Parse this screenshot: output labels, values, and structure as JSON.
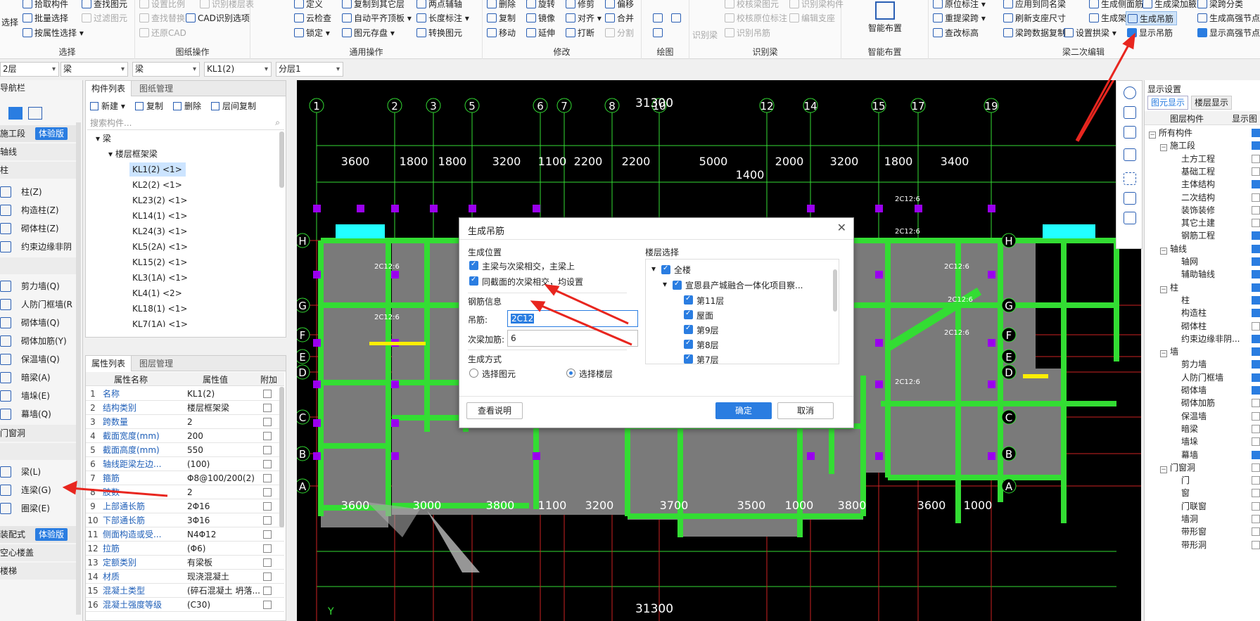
{
  "ribbon": {
    "row1": [
      {
        "label": "拾取构件"
      },
      {
        "label": "查找图元"
      },
      {
        "label": "设置比例"
      },
      {
        "label": "识别楼层表"
      },
      {
        "label": "定义"
      },
      {
        "label": "复制到其它层"
      },
      {
        "label": "两点辅轴"
      },
      {
        "label": "删除"
      },
      {
        "label": "旋转"
      },
      {
        "label": "修剪"
      },
      {
        "label": "偏移"
      },
      {
        "label": "原位标注"
      },
      {
        "label": "应用到同名梁"
      },
      {
        "label": "生成侧面筋"
      },
      {
        "label": "生成架立筋"
      },
      {
        "label": "梁跨分类"
      }
    ],
    "select_label": "选择",
    "select_items": [
      {
        "label": "批量选择"
      },
      {
        "label": "按属性选择"
      },
      {
        "label": "过滤图元"
      }
    ],
    "drawing_ops": [
      {
        "label": "查找替换"
      },
      {
        "label": "还原CAD"
      },
      {
        "label": "CAD识别选项"
      }
    ],
    "general_ops": [
      {
        "label": "云检查"
      },
      {
        "label": "锁定"
      },
      {
        "label": "自动平齐顶板"
      },
      {
        "label": "图元存盘"
      },
      {
        "label": "长度标注"
      },
      {
        "label": "转换图元"
      }
    ],
    "modify_ops": [
      {
        "label": "复制"
      },
      {
        "label": "移动"
      },
      {
        "label": "镜像"
      },
      {
        "label": "延伸"
      },
      {
        "label": "对齐"
      },
      {
        "label": "打断"
      },
      {
        "label": "合并"
      },
      {
        "label": "分割"
      }
    ],
    "beam_recog": [
      {
        "label": "识别梁"
      },
      {
        "label": "校核原位标注"
      },
      {
        "label": "编辑支座"
      },
      {
        "label": "识别吊筋"
      },
      {
        "label": "校核梁图元"
      },
      {
        "label": "识别梁构件"
      }
    ],
    "smart_label": "智能布置",
    "beam2": [
      {
        "label": "重提梁跨"
      },
      {
        "label": "刷新支座尺寸"
      },
      {
        "label": "查改标高"
      },
      {
        "label": "梁跨数据复制"
      },
      {
        "label": "设置拱梁"
      },
      {
        "label": "生成架立筋"
      },
      {
        "label": "生成吊筋"
      },
      {
        "label": "显示吊筋"
      },
      {
        "label": "生成高强节点"
      },
      {
        "label": "显示高强节点"
      },
      {
        "label": "生成梁加腋"
      }
    ],
    "groups": [
      "选择",
      "图纸操作",
      "通用操作",
      "修改",
      "绘图",
      "识别梁",
      "智能布置",
      "梁二次编辑"
    ]
  },
  "toolbar2": {
    "floor": "2层",
    "type": "梁",
    "sub": "梁",
    "component": "KL1(2)",
    "layer": "分层1"
  },
  "nav": {
    "title": "导航栏",
    "sections": [
      {
        "label": "施工段",
        "badge": "体验版"
      },
      {
        "label": "轴线"
      },
      {
        "label": "柱"
      }
    ],
    "items": [
      "柱(Z)",
      "构造柱(Z)",
      "砌体柱(Z)",
      "约束边缘非阴",
      "剪力墙(Q)",
      "人防门框墙(R",
      "砌体墙(Q)",
      "砌体加筋(Y)",
      "保温墙(Q)",
      "暗梁(A)",
      "墙垛(E)",
      "幕墙(Q)"
    ],
    "sec2": "门窗洞",
    "beam_items": [
      "梁(L)",
      "连梁(G)",
      "圈梁(E)"
    ],
    "sec3": {
      "label": "装配式",
      "badge": "体验版"
    },
    "sec4": "空心楼盖",
    "sec5": "楼梯"
  },
  "comp": {
    "tabs": [
      "构件列表",
      "图纸管理"
    ],
    "toolbar": [
      "新建",
      "复制",
      "删除",
      "层间复制"
    ],
    "search_placeholder": "搜索构件...",
    "root": "梁",
    "group": "楼层框架梁",
    "items": [
      "KL1(2) <1>",
      "KL2(2) <1>",
      "KL23(2) <1>",
      "KL14(1) <1>",
      "KL24(3) <1>",
      "KL5(2A) <1>",
      "KL15(2) <1>",
      "KL3(1A) <1>",
      "KL4(1) <2>",
      "KL18(1) <1>",
      "KL7(1A) <1>"
    ]
  },
  "prop": {
    "tabs": [
      "属性列表",
      "图层管理"
    ],
    "headers": [
      "属性名称",
      "属性值",
      "附加"
    ],
    "rows": [
      {
        "n": "1",
        "k": "名称",
        "v": "KL1(2)"
      },
      {
        "n": "2",
        "k": "结构类别",
        "v": "楼层框架梁"
      },
      {
        "n": "3",
        "k": "跨数量",
        "v": "2"
      },
      {
        "n": "4",
        "k": "截面宽度(mm)",
        "v": "200"
      },
      {
        "n": "5",
        "k": "截面高度(mm)",
        "v": "550"
      },
      {
        "n": "6",
        "k": "轴线距梁左边...",
        "v": "(100)"
      },
      {
        "n": "7",
        "k": "箍筋",
        "v": "Φ8@100/200(2)"
      },
      {
        "n": "8",
        "k": "肢数",
        "v": "2"
      },
      {
        "n": "9",
        "k": "上部通长筋",
        "v": "2Φ16"
      },
      {
        "n": "10",
        "k": "下部通长筋",
        "v": "3Φ16"
      },
      {
        "n": "11",
        "k": "侧面构造或受...",
        "v": "N4Φ12"
      },
      {
        "n": "12",
        "k": "拉筋",
        "v": "(Φ6)"
      },
      {
        "n": "13",
        "k": "定额类别",
        "v": "有梁板"
      },
      {
        "n": "14",
        "k": "材质",
        "v": "现浇混凝土"
      },
      {
        "n": "15",
        "k": "混凝土类型",
        "v": "(碎石混凝土 坍落..."
      },
      {
        "n": "16",
        "k": "混凝土强度等级",
        "v": "(C30)"
      }
    ]
  },
  "canvas": {
    "axes_top": [
      "1",
      "2",
      "3",
      "5",
      "6",
      "7",
      "8",
      "10",
      "12",
      "14",
      "15",
      "17",
      "19"
    ],
    "axes_side": [
      "H",
      "G",
      "F",
      "E",
      "D",
      "C",
      "B",
      "A"
    ],
    "total_top": "31300",
    "total_bottom": "31300",
    "dims_top": [
      "3600",
      "1800",
      "1800",
      "3200",
      "1100",
      "2200",
      "2200",
      "5000",
      "2000",
      "3200",
      "1800",
      "3400"
    ],
    "dim_1400": "1400",
    "dims_bottom": [
      "3600",
      "3000",
      "3800",
      "1100",
      "3200",
      "3700",
      "3500",
      "1000",
      "3800",
      "3600",
      "1000"
    ],
    "rebar_labels": [
      "2C12:6",
      "2C12:6",
      "2C12:6",
      "2C12:6",
      "2C12:6",
      "2C12:6",
      "2C12:6",
      "2C12:6",
      "2C12:6",
      "2C12:6",
      "2C12:6",
      "2C12:6",
      "2C12:6",
      "2C12:6"
    ],
    "corner": "Y"
  },
  "dialog": {
    "title": "生成吊筋",
    "pos_label": "生成位置",
    "opt1": "主梁与次梁相交，主梁上",
    "opt2": "同截面的次梁相交，均设置",
    "rebar_info": "钢筋信息",
    "hanger_label": "吊筋:",
    "hanger_value": "2C12",
    "add_label": "次梁加筋:",
    "add_value": "6",
    "method_label": "生成方式",
    "radio1": "选择图元",
    "radio2": "选择楼层",
    "floor_label": "楼层选择",
    "floors": [
      "全楼",
      "宣恩县产城融合一体化项目察...",
      "第11层",
      "屋面",
      "第9层",
      "第8层",
      "第7层"
    ],
    "help_btn": "查看说明",
    "ok_btn": "确定",
    "cancel_btn": "取消"
  },
  "rpanel": {
    "title": "显示设置",
    "tabs": [
      "图元显示",
      "楼层显示"
    ],
    "headers": [
      "图层构件",
      "显示图"
    ],
    "rows": [
      {
        "label": "所有构件",
        "lvl": 0,
        "on": true,
        "exp": true
      },
      {
        "label": "施工段",
        "lvl": 1,
        "on": true,
        "exp": true
      },
      {
        "label": "土方工程",
        "lvl": 2,
        "on": false
      },
      {
        "label": "基础工程",
        "lvl": 2,
        "on": false
      },
      {
        "label": "主体结构",
        "lvl": 2,
        "on": true
      },
      {
        "label": "二次结构",
        "lvl": 2,
        "on": false
      },
      {
        "label": "装饰装修",
        "lvl": 2,
        "on": false
      },
      {
        "label": "其它土建",
        "lvl": 2,
        "on": false
      },
      {
        "label": "钢筋工程",
        "lvl": 2,
        "on": true
      },
      {
        "label": "轴线",
        "lvl": 1,
        "on": true,
        "exp": true
      },
      {
        "label": "轴网",
        "lvl": 2,
        "on": true
      },
      {
        "label": "辅助轴线",
        "lvl": 2,
        "on": true
      },
      {
        "label": "柱",
        "lvl": 1,
        "on": true,
        "exp": true
      },
      {
        "label": "柱",
        "lvl": 2,
        "on": true
      },
      {
        "label": "构造柱",
        "lvl": 2,
        "on": true
      },
      {
        "label": "砌体柱",
        "lvl": 2,
        "on": false
      },
      {
        "label": "约束边缘非阴...",
        "lvl": 2,
        "on": true
      },
      {
        "label": "墙",
        "lvl": 1,
        "on": true,
        "exp": true
      },
      {
        "label": "剪力墙",
        "lvl": 2,
        "on": true
      },
      {
        "label": "人防门框墙",
        "lvl": 2,
        "on": true
      },
      {
        "label": "砌体墙",
        "lvl": 2,
        "on": true
      },
      {
        "label": "砌体加筋",
        "lvl": 2,
        "on": false
      },
      {
        "label": "保温墙",
        "lvl": 2,
        "on": false
      },
      {
        "label": "暗梁",
        "lvl": 2,
        "on": false
      },
      {
        "label": "墙垛",
        "lvl": 2,
        "on": false
      },
      {
        "label": "幕墙",
        "lvl": 2,
        "on": true
      },
      {
        "label": "门窗洞",
        "lvl": 1,
        "on": false,
        "exp": true
      },
      {
        "label": "门",
        "lvl": 2,
        "on": false
      },
      {
        "label": "窗",
        "lvl": 2,
        "on": false
      },
      {
        "label": "门联窗",
        "lvl": 2,
        "on": false
      },
      {
        "label": "墙洞",
        "lvl": 2,
        "on": false
      },
      {
        "label": "带形窗",
        "lvl": 2,
        "on": false
      },
      {
        "label": "带形洞",
        "lvl": 2,
        "on": false
      }
    ]
  },
  "colors": {
    "accent": "#2a7de1",
    "grid_green": "#33dd33",
    "axis_red": "#dd2222",
    "column": "#9900ee",
    "slab": "#808080"
  }
}
